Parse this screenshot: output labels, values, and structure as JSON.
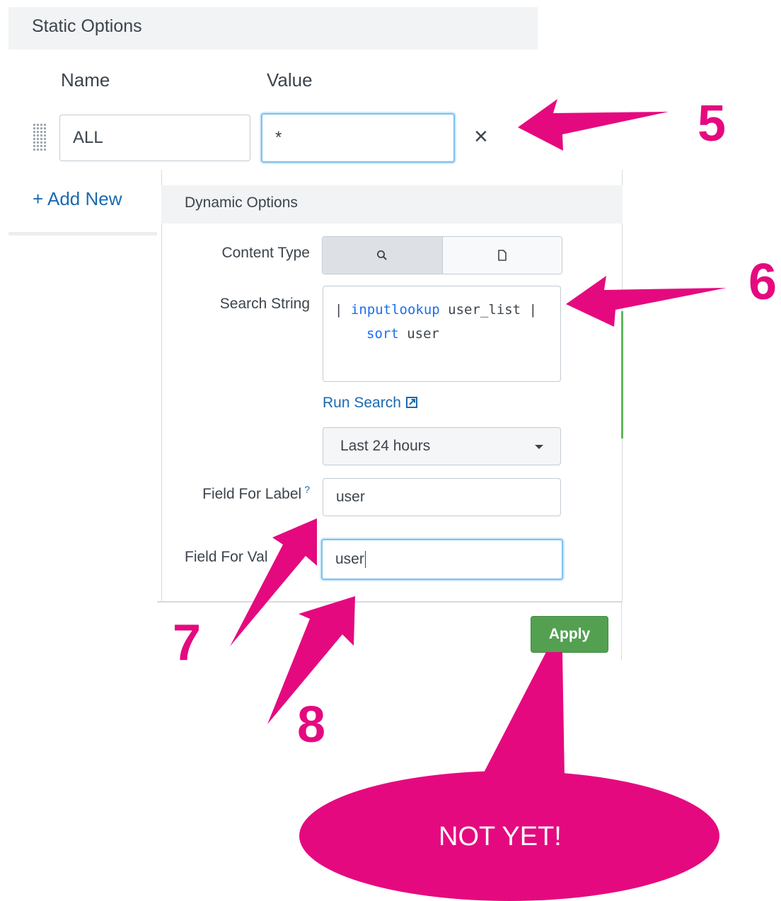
{
  "static_options": {
    "title": "Static Options",
    "name_header": "Name",
    "value_header": "Value",
    "row": {
      "name": "ALL",
      "value": "*"
    },
    "remove_glyph": "×",
    "add_new": "+ Add New"
  },
  "dynamic_options": {
    "title": "Dynamic Options",
    "content_type_label": "Content Type",
    "content_type_options": [
      "search-icon",
      "document-icon"
    ],
    "search_string_label": "Search String",
    "search_string": {
      "line1_pre": "| ",
      "line1_kw": "inputlookup",
      "line1_post": " user_list |",
      "line2_kw": "sort",
      "line2_post": " user"
    },
    "run_search": "Run Search",
    "time_range": "Last 24 hours",
    "field_for_label_label": "Field For Label",
    "help_mark": "?",
    "field_for_label_value": "user",
    "field_for_value_label": "Field For Val",
    "field_for_value_value": "user",
    "apply": "Apply"
  },
  "annotations": {
    "step5": "5",
    "step6": "6",
    "step7": "7",
    "step8": "8",
    "bubble": "NOT YET!",
    "color": "#e5097f"
  }
}
